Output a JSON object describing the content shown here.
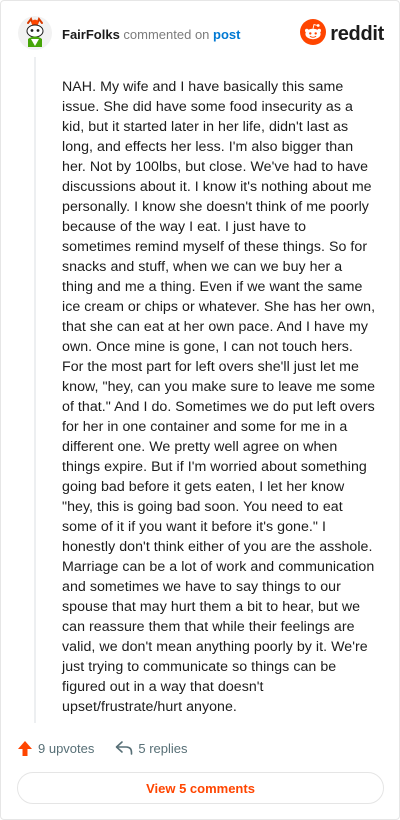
{
  "header": {
    "author": "FairFolks",
    "verb": "commented on",
    "post_link": "post",
    "brand": "reddit",
    "avatar_icon": "snoo-avatar-icon",
    "brand_icon": "reddit-logo-icon"
  },
  "comment": {
    "body": "NAH. My wife and I have basically this same issue. She did have some food insecurity as a kid, but it started later in her life, didn't last as long, and effects her less. I'm also bigger than her. Not by 100lbs, but close. We've had to have discussions about it. I know it's nothing about me personally. I know she doesn't think of me poorly because of the way I eat. I just have to sometimes remind myself of these things. So for snacks and stuff, when we can we buy her a thing and me a thing. Even if we want the same ice cream or chips or whatever. She has her own, that she can eat at her own pace. And I have my own. Once mine is gone, I can not touch hers. For the most part for left overs she'll just let me know, \"hey, can you make sure to leave me some of that.\" And I do. Sometimes we do put left overs for her in one container and some for me in a different one. We pretty well agree on when things expire. But if I'm worried about something going bad before it gets eaten, I let her know \"hey, this is going bad soon. You need to eat some of it if you want it before it's gone.\" I honestly don't think either of you are the asshole. Marriage can be a lot of work and communication and sometimes we have to say things to our spouse that may hurt them a bit to hear, but we can reassure them that while their feelings are valid, we don't mean anything poorly by it. We're just trying to communicate so things can be figured out in a way that doesn't upset/frustrate/hurt anyone."
  },
  "actions": {
    "upvotes": "9 upvotes",
    "replies": "5 replies",
    "upvote_icon": "upvote-arrow-icon",
    "reply_icon": "reply-arrow-icon"
  },
  "view_comments": "View 5 comments",
  "colors": {
    "accent": "#ff4500",
    "link": "#0079d3",
    "muted": "#576f76"
  }
}
